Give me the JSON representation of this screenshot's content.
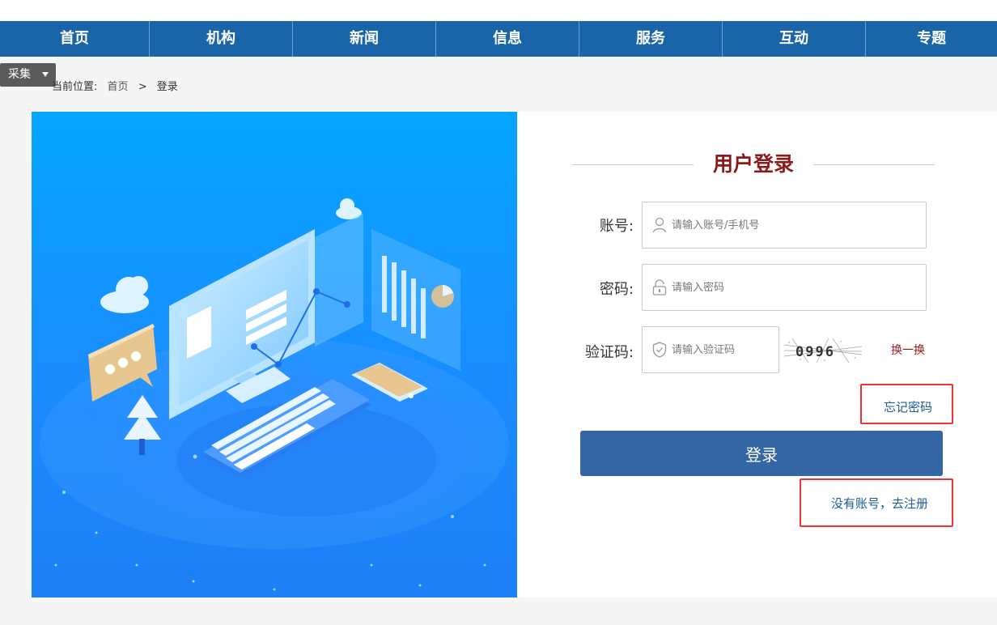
{
  "nav": {
    "items": [
      {
        "label": "首页",
        "width": 185
      },
      {
        "label": "机构",
        "width": 177
      },
      {
        "label": "新闻",
        "width": 177
      },
      {
        "label": "信息",
        "width": 177
      },
      {
        "label": "服务",
        "width": 177
      },
      {
        "label": "互动",
        "width": 177
      },
      {
        "label": "专题",
        "width": 162
      }
    ]
  },
  "collect": {
    "label": "采集"
  },
  "breadcrumb": {
    "prefix": "当前位置:",
    "home": "首页",
    "sep": ">",
    "current": "登录"
  },
  "login": {
    "title": "用户登录",
    "account_label": "账号:",
    "account_placeholder": "请输入账号/手机号",
    "password_label": "密码:",
    "password_placeholder": "请输入密码",
    "captcha_label": "验证码:",
    "captcha_placeholder": "请输入验证码",
    "captcha_text": "0996",
    "refresh_label": "换一换",
    "forgot_label": "忘记密码",
    "submit_label": "登录",
    "register_label": "没有账号，去注册"
  },
  "colors": {
    "nav": "#1a64a8",
    "title": "#8b1a1a",
    "button": "#3366a3",
    "highlight": "#e33333"
  }
}
